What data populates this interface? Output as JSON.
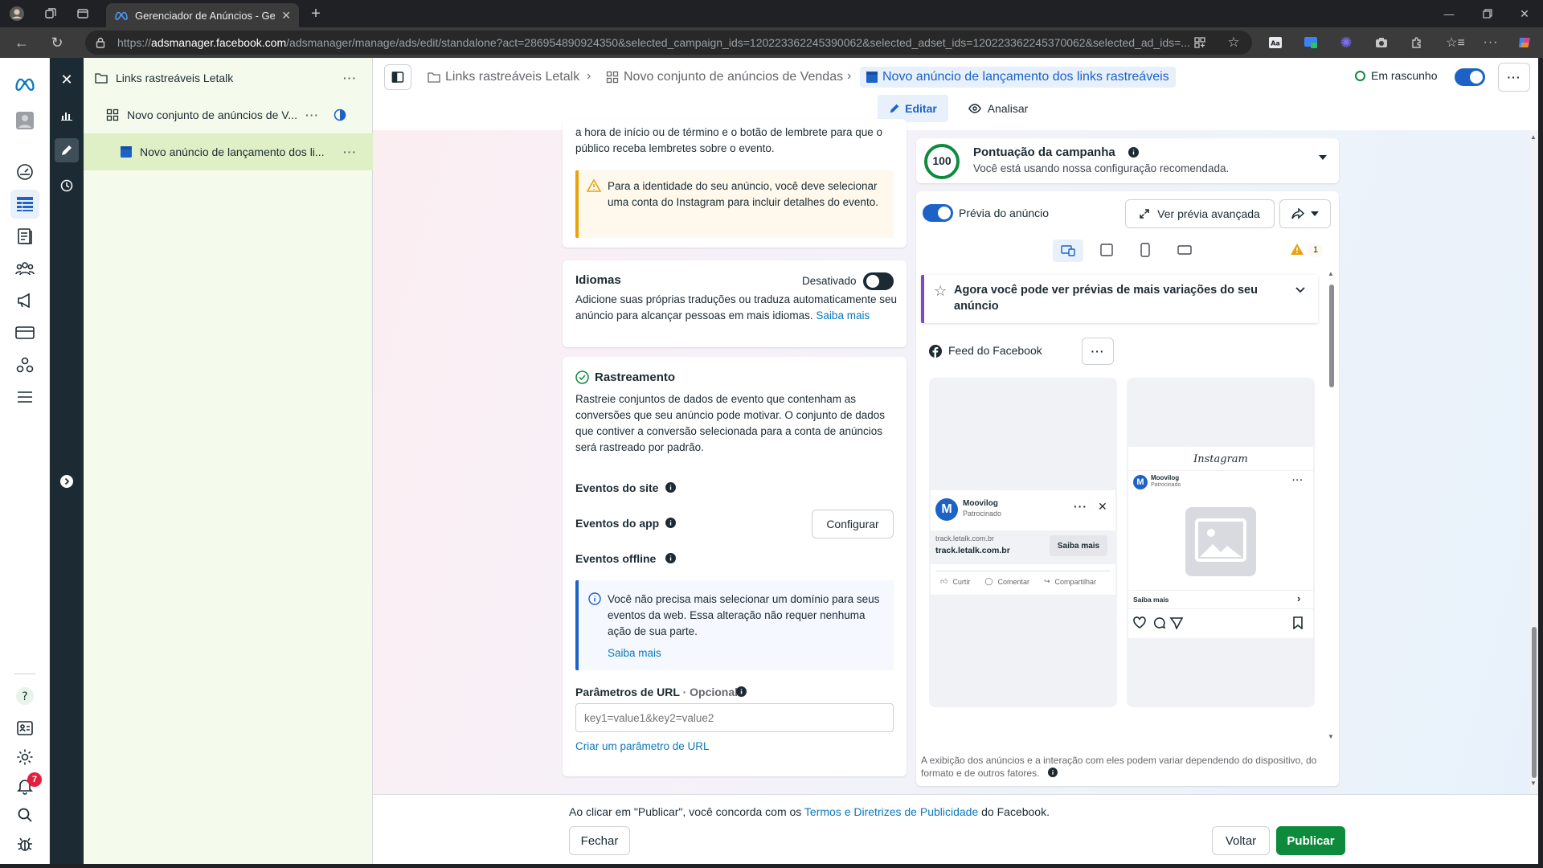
{
  "browser": {
    "tab_title": "Gerenciador de Anúncios - Gerenciador de Anúncios",
    "url_host": "adsmanager.facebook.com",
    "url_prefix": "https://",
    "url_path": "/adsmanager/manage/ads/edit/standalone?act=286954890924350&selected_campaign_ids=120223362245390062&selected_adset_ids=120223362245370062&selected_ad_ids=..."
  },
  "left_rail": {
    "notification_count": "7"
  },
  "tree": {
    "campaign": "Links rastreáveis Letalk",
    "adset": "Novo conjunto de anúncios de V...",
    "ad": "Novo anúncio de lançamento dos li..."
  },
  "header": {
    "crumb_campaign": "Links rastreáveis Letalk",
    "crumb_adset": "Novo conjunto de anúncios de Vendas",
    "crumb_ad": "Novo anúncio de lançamento dos links rastreáveis",
    "status": "Em rascunho",
    "tab_edit": "Editar",
    "tab_analyze": "Analisar"
  },
  "editor": {
    "top_text": "a hora de início ou de término e o botão de lembrete para que o público receba lembretes sobre o evento.",
    "warning": "Para a identidade do seu anúncio, você deve selecionar uma conta do Instagram para incluir detalhes do evento.",
    "languages": {
      "title": "Idiomas",
      "state": "Desativado",
      "desc": "Adicione suas próprias traduções ou traduza automaticamente seu anúncio para alcançar pessoas em mais idiomas.",
      "link": "Saiba mais"
    },
    "tracking": {
      "title": "Rastreamento",
      "desc": "Rastreie conjuntos de dados de evento que contenham as conversões que seu anúncio pode motivar. O conjunto de dados que contiver a conversão selecionada para a conta de anúncios será rastreado por padrão.",
      "site_events": "Eventos do site",
      "app_events": "Eventos do app",
      "configure": "Configurar",
      "offline_events": "Eventos offline",
      "info": "Você não precisa mais selecionar um domínio para seus eventos da web. Essa alteração não requer nenhuma ação de sua parte.",
      "info_link": "Saiba mais",
      "url_params_label": "Parâmetros de URL",
      "url_params_optional": " · Opcional",
      "url_params_placeholder": "key1=value1&key2=value2",
      "create_param": "Criar um parâmetro de URL"
    }
  },
  "preview": {
    "score": "100",
    "score_title": "Pontuação da campanha",
    "score_sub": "Você está usando nossa configuração recomendada.",
    "toggle_label": "Prévia do anúncio",
    "advanced": "Ver prévia avançada",
    "warning_count": "1",
    "banner": "Agora você pode ver prévias de mais variações do seu anúncio",
    "placement": "Feed do Facebook",
    "fb": {
      "page": "Moovilog",
      "sponsored": "Patrocinado",
      "domain_small": "track.letalk.com.br",
      "domain": "track.letalk.com.br",
      "cta": "Saiba mais",
      "like": "Curtir",
      "comment": "Comentar",
      "share": "Compartilhar"
    },
    "ig": {
      "logo": "Instagram",
      "page": "Moovilog",
      "sponsored": "Patrocinado",
      "cta": "Saiba mais"
    },
    "disclaimer": "A exibição dos anúncios e a interação com eles podem variar dependendo do dispositivo, do formato e de outros fatores."
  },
  "footer": {
    "terms_pre": "Ao clicar em \"Publicar\", você concorda com os ",
    "terms_link": "Termos e Diretrizes de Publicidade",
    "terms_post": " do Facebook.",
    "close": "Fechar",
    "back": "Voltar",
    "publish": "Publicar"
  },
  "colors": {
    "accent": "#0a78be",
    "publish": "#0e8a3c",
    "tree_bg": "#f5fbec",
    "dark_rail": "#1c2b33"
  }
}
